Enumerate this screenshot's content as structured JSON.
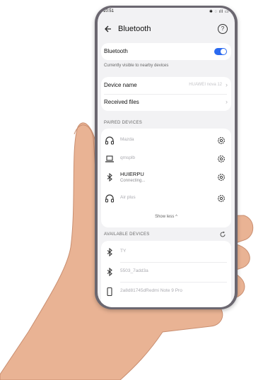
{
  "status_bar": {
    "time": "10:51",
    "icons": "✱ ◌ ıll ▭"
  },
  "header": {
    "title": "Bluetooth",
    "back_icon": "arrow-left-icon",
    "help_icon": "help-circle-icon"
  },
  "bluetooth": {
    "label": "Bluetooth",
    "enabled": true,
    "visibility_note": "Currently visible to nearby devices"
  },
  "device_name": {
    "label": "Device name",
    "value": "HUAWEI nova 12"
  },
  "received_files": {
    "label": "Received files"
  },
  "paired": {
    "header": "PAIRED DEVICES",
    "devices": [
      {
        "icon": "headphones-icon",
        "name": "Mazda",
        "status": ""
      },
      {
        "icon": "laptop-icon",
        "name": "qmsplb",
        "status": ""
      },
      {
        "icon": "bluetooth-icon",
        "name": "HUIERPU",
        "status": "Connecting..."
      },
      {
        "icon": "headphones-icon",
        "name": "Air plus",
        "status": ""
      }
    ],
    "show_less": "Show less ^"
  },
  "available": {
    "header": "AVAILABLE DEVICES",
    "devices": [
      {
        "icon": "bluetooth-icon",
        "name": "TY"
      },
      {
        "icon": "bluetooth-icon",
        "name": "5503_7add3a"
      },
      {
        "icon": "phone-icon",
        "name": "2a8d81745dRedmi Note 9 Pro"
      }
    ]
  },
  "colors": {
    "accent": "#2b6af0",
    "screen_bg": "#f2f2f4",
    "phone_frame": "#6b6770"
  }
}
